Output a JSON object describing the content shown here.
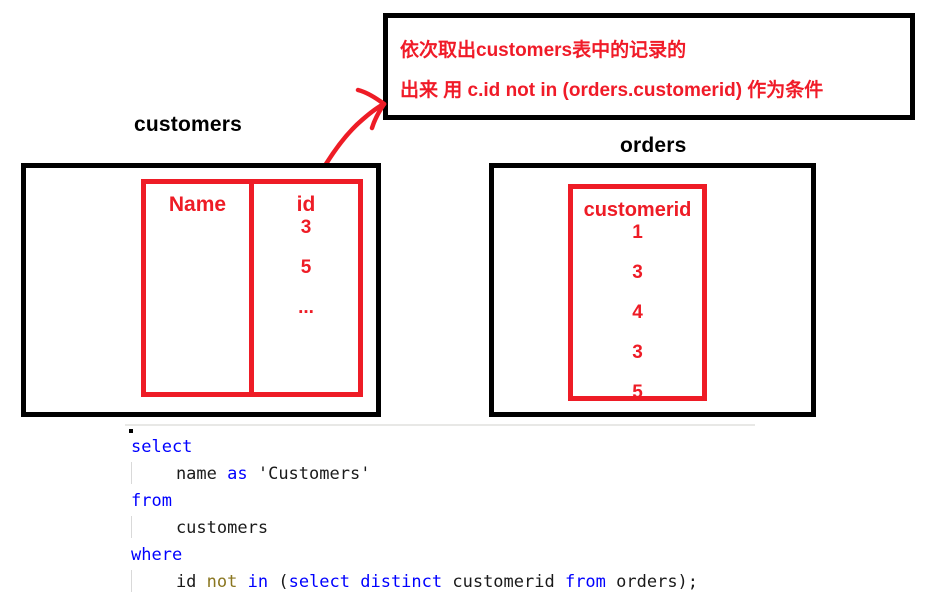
{
  "annotation": {
    "line1": "依次取出customers表中的记录的",
    "line2": "出来  用 c.id  not in (orders.customerid) 作为条件",
    "text_color": "#f01b28",
    "border_color": "#000000"
  },
  "arrow": {
    "name": "hand-drawn-arrow",
    "color": "#ee1c26",
    "from": "customers.id column",
    "to": "annotation box"
  },
  "customers_table": {
    "title": "customers",
    "frame_color": "#000000",
    "highlight_color": "#ee1c26",
    "columns": [
      {
        "header": "Name",
        "values": []
      },
      {
        "header": "id",
        "values": [
          "3",
          "5",
          "..."
        ]
      }
    ]
  },
  "orders_table": {
    "title": "orders",
    "frame_color": "#000000",
    "highlight_color": "#ee1c26",
    "columns": [
      {
        "header": "customerid",
        "values": [
          "1",
          "3",
          "4",
          "3",
          "5"
        ]
      }
    ]
  },
  "code": {
    "language": "sql",
    "full_text": "select\n    name as 'Customers'\nfrom\n    customers\nwhere\n    id not in (select distinct customerid from orders);",
    "lines": [
      {
        "indent": false,
        "tokens": [
          {
            "t": "select",
            "c": "kw"
          }
        ]
      },
      {
        "indent": true,
        "tokens": [
          {
            "t": "    name ",
            "c": "plain"
          },
          {
            "t": "as",
            "c": "kw"
          },
          {
            "t": " 'Customers'",
            "c": "str"
          }
        ]
      },
      {
        "indent": false,
        "tokens": [
          {
            "t": "from",
            "c": "kw"
          }
        ]
      },
      {
        "indent": true,
        "tokens": [
          {
            "t": "    customers",
            "c": "plain"
          }
        ]
      },
      {
        "indent": false,
        "tokens": [
          {
            "t": "where",
            "c": "kw"
          }
        ]
      },
      {
        "indent": true,
        "tokens": [
          {
            "t": "    id ",
            "c": "plain"
          },
          {
            "t": "not",
            "c": "op"
          },
          {
            "t": " ",
            "c": "plain"
          },
          {
            "t": "in",
            "c": "kw"
          },
          {
            "t": " (",
            "c": "plain"
          },
          {
            "t": "select distinct",
            "c": "kw"
          },
          {
            "t": " customerid ",
            "c": "plain"
          },
          {
            "t": "from",
            "c": "kw"
          },
          {
            "t": " orders);",
            "c": "plain"
          }
        ]
      }
    ],
    "keyword_color": "#0000ff",
    "operator_color": "#8a7620",
    "plain_color": "#1a1a1a"
  }
}
